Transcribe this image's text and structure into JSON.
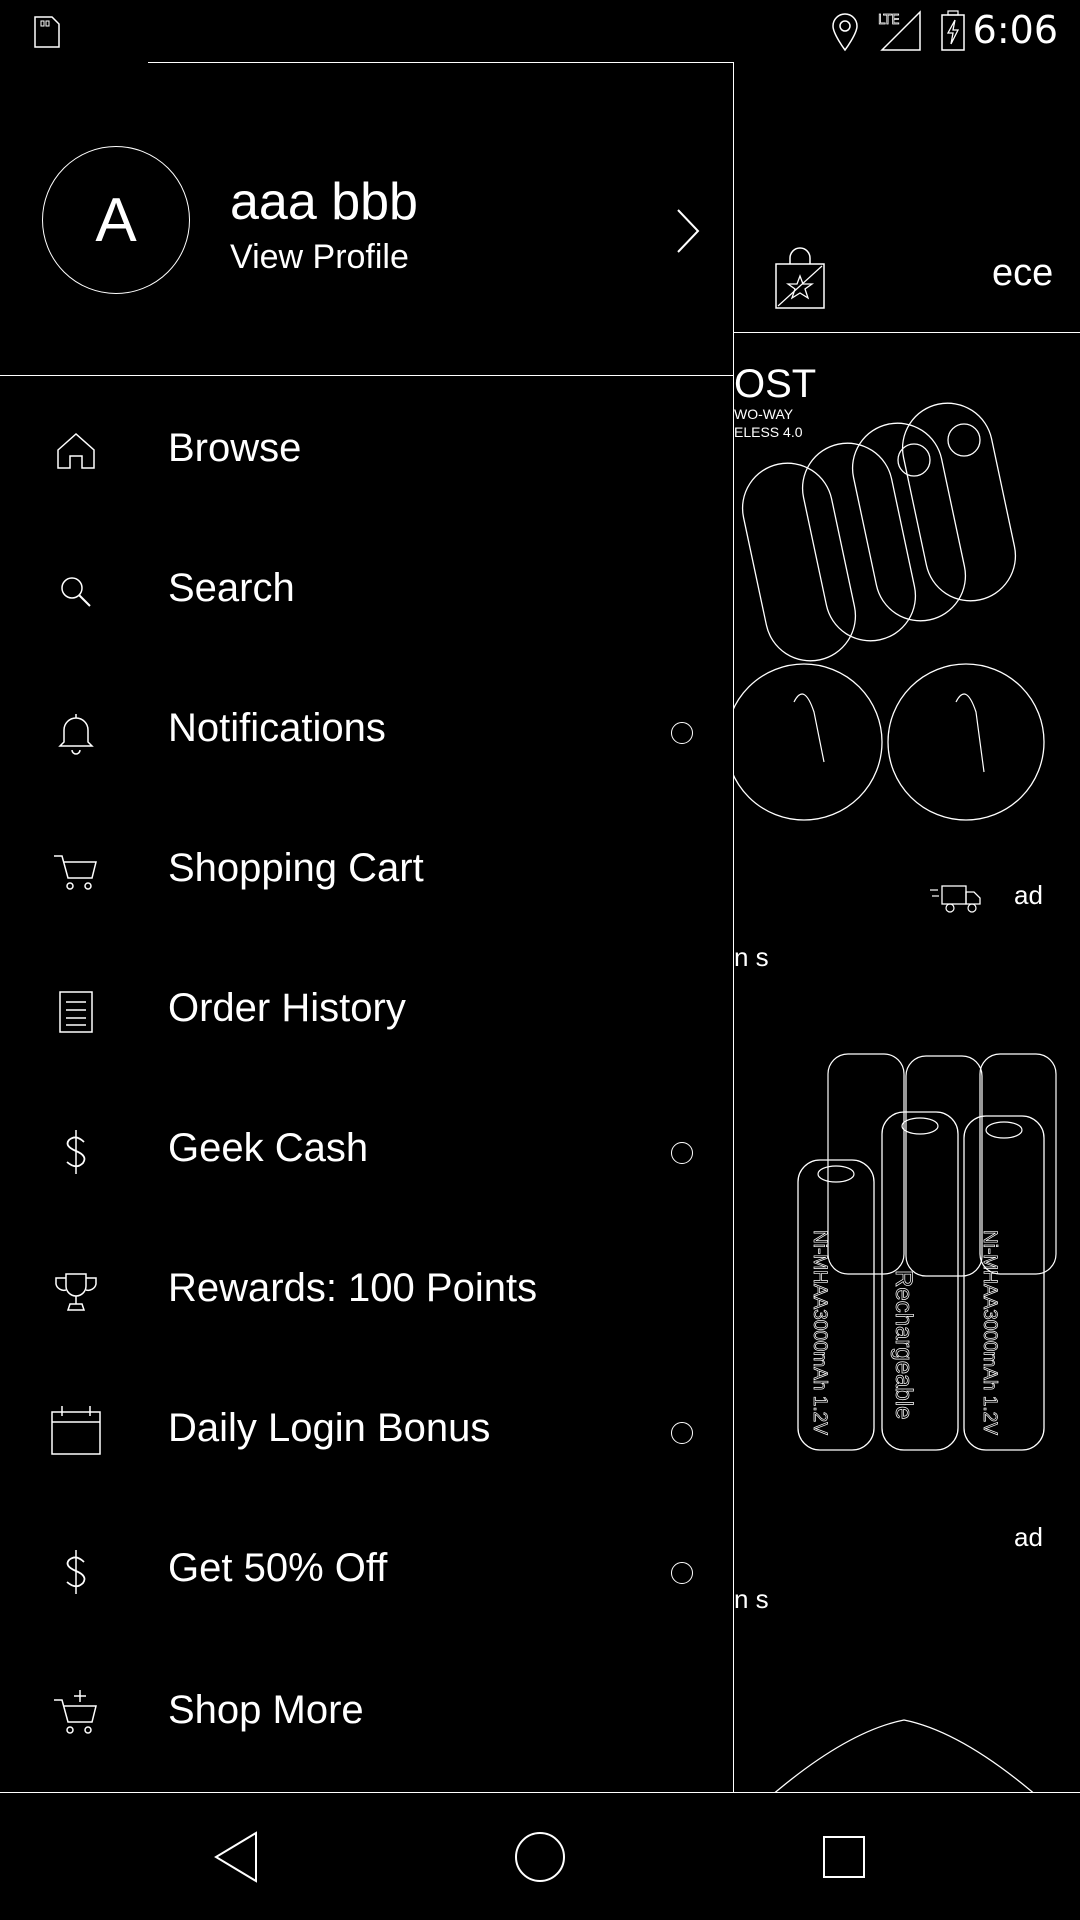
{
  "status_bar": {
    "time": "6:06",
    "icons": [
      "sim-card-icon",
      "location-icon",
      "lte-signal-icon",
      "battery-charging-icon"
    ],
    "network": "LTE"
  },
  "profile": {
    "avatar_letter": "A",
    "name": "aaa bbb",
    "link": "View Profile"
  },
  "menu": {
    "items": [
      {
        "label": "Browse",
        "icon": "home-icon",
        "dot": false
      },
      {
        "label": "Search",
        "icon": "search-icon",
        "dot": false
      },
      {
        "label": "Notifications",
        "icon": "bell-icon",
        "dot": true
      },
      {
        "label": "Shopping Cart",
        "icon": "cart-icon",
        "dot": false
      },
      {
        "label": "Order History",
        "icon": "receipt-icon",
        "dot": false
      },
      {
        "label": "Geek Cash",
        "icon": "dollar-icon",
        "dot": true
      },
      {
        "label": "Rewards: 100 Points",
        "icon": "trophy-icon",
        "dot": false
      },
      {
        "label": "Daily Login Bonus",
        "icon": "calendar-icon",
        "dot": true
      },
      {
        "label": "Get 50% Off",
        "icon": "dollar-icon",
        "dot": true
      },
      {
        "label": "Shop More",
        "icon": "cart-plus-icon",
        "dot": false
      }
    ]
  },
  "background": {
    "header_partial_text": "ece",
    "product1": {
      "brand_text": "OST",
      "sub1": "WO-WAY",
      "sub2": "ELESS 4.0",
      "shipping_text": "ad",
      "caption_partial": "n s"
    },
    "product2": {
      "label_line1": "Ni-MHAA3000mAh 1.2V",
      "label_line2": "Rechargeable",
      "shipping_text": "ad",
      "caption_partial": "n s"
    }
  },
  "nav_bar": {
    "buttons": [
      "back-icon",
      "home-circle-icon",
      "recents-icon"
    ]
  }
}
